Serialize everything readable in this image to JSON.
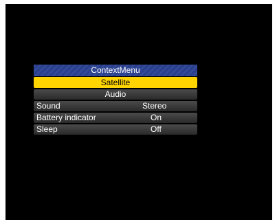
{
  "menu": {
    "title": "ContextMenu",
    "items": [
      {
        "label": "Satellite",
        "value": "",
        "selected": true
      },
      {
        "label": "Audio",
        "value": "",
        "selected": false
      },
      {
        "label": "Sound",
        "value": "Stereo",
        "selected": false
      },
      {
        "label": "Battery indicator",
        "value": "On",
        "selected": false
      },
      {
        "label": "Sleep",
        "value": "Off",
        "selected": false
      }
    ]
  },
  "colors": {
    "screen_background": "#000000",
    "title_bar": "#334a9a",
    "selected_item": "#ffd400",
    "item_background": "#3a3a3a",
    "text": "#ffffff"
  }
}
